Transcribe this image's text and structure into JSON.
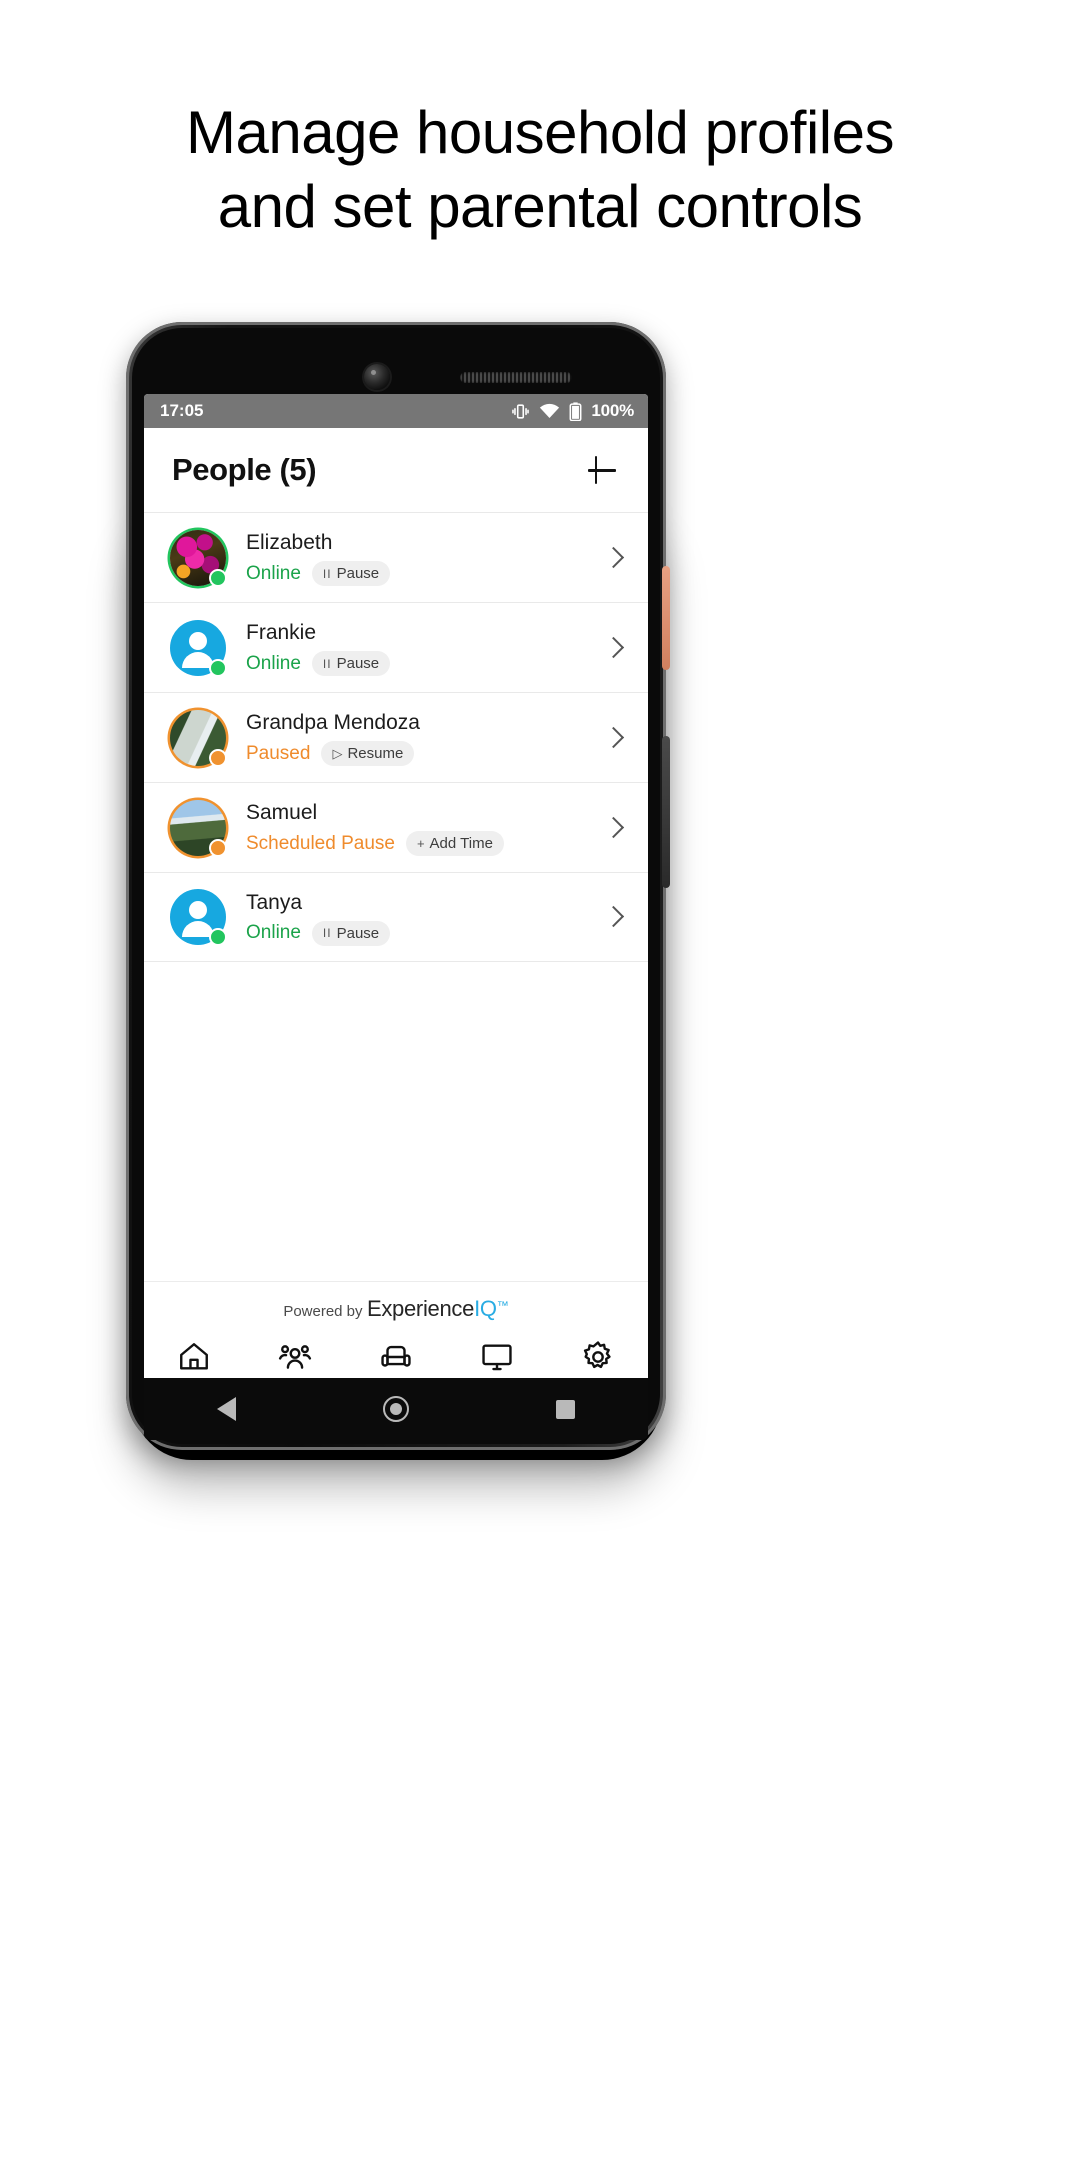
{
  "headline": {
    "line1": "Manage household profiles",
    "line2": "and set parental controls"
  },
  "statusbar": {
    "time": "17:05",
    "battery_percent": "100%",
    "icons": [
      "vibrate-icon",
      "wifi-icon",
      "battery-icon"
    ]
  },
  "header": {
    "title": "People (5)",
    "add_label": "+"
  },
  "people": [
    {
      "name": "Elizabeth",
      "status": "Online",
      "status_type": "online",
      "action_label": "Pause",
      "action_glyph": "II",
      "avatar": "photo-flowers",
      "dot": "green"
    },
    {
      "name": "Frankie",
      "status": "Online",
      "status_type": "online",
      "action_label": "Pause",
      "action_glyph": "II",
      "avatar": "icon-person",
      "dot": "green"
    },
    {
      "name": "Grandpa Mendoza",
      "status": "Paused",
      "status_type": "paused",
      "action_label": "Resume",
      "action_glyph": "▷",
      "avatar": "photo-waterfall",
      "dot": "orange"
    },
    {
      "name": "Samuel",
      "status": "Scheduled Pause",
      "status_type": "paused",
      "action_label": "Add Time",
      "action_glyph": "+",
      "avatar": "photo-canyon",
      "dot": "orange"
    },
    {
      "name": "Tanya",
      "status": "Online",
      "status_type": "online",
      "action_label": "Pause",
      "action_glyph": "II",
      "avatar": "icon-person",
      "dot": "green"
    }
  ],
  "brand": {
    "powered_by": "Powered by",
    "name_dark": "Experience",
    "name_accent": "IQ",
    "trademark": "™"
  },
  "bottom_nav": [
    {
      "icon": "home-icon",
      "active": false
    },
    {
      "icon": "people-icon",
      "active": true
    },
    {
      "icon": "sofa-icon",
      "active": false
    },
    {
      "icon": "monitor-icon",
      "active": false
    },
    {
      "icon": "gear-icon",
      "active": false
    }
  ],
  "android_nav": {
    "back": "back-icon",
    "home": "home-circle-icon",
    "recents": "recents-square-icon"
  },
  "colors": {
    "accent": "#29ace3",
    "online": "#1ba34a",
    "paused": "#ef8b2c",
    "avatar_blue": "#17a8e0",
    "statusbar_bg": "#767676"
  }
}
